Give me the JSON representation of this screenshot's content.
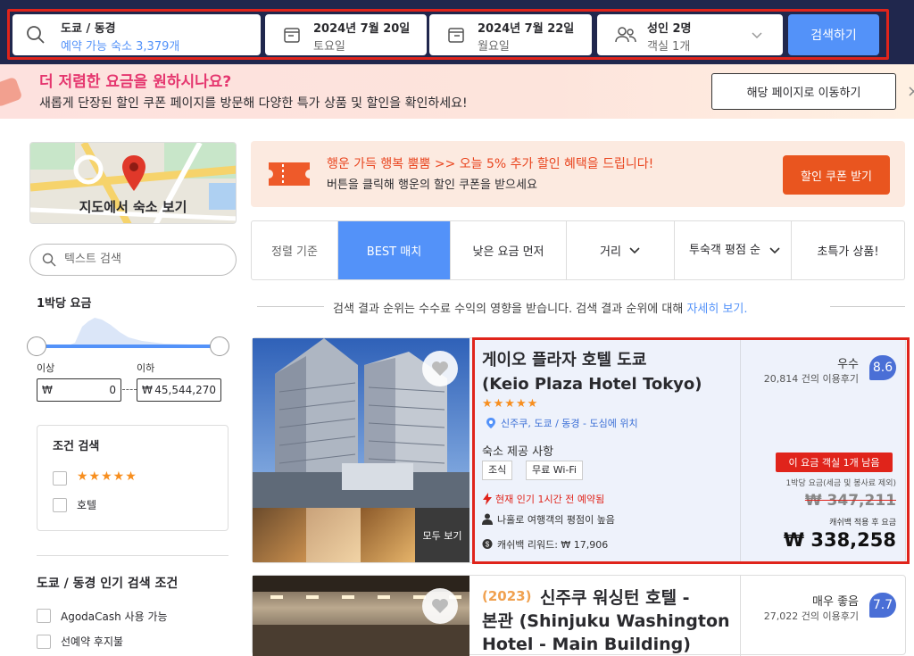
{
  "search": {
    "destination": "도쿄 / 동경",
    "destination_sub": "예약 가능 숙소 3,379개",
    "checkin": "2024년 7월 20일",
    "checkin_day": "토요일",
    "checkout": "2024년 7월 22일",
    "checkout_day": "월요일",
    "guests": "성인 2명",
    "rooms": "객실 1개",
    "search_button": "검색하기"
  },
  "promo": {
    "title": "더 저렴한 요금을 원하시나요?",
    "subtitle": "새롭게 단장된 할인 쿠폰 페이지를 방문해 다양한 특가 상품 및 할인을 확인하세요!",
    "button": "해당 페이지로 이동하기",
    "close": "×"
  },
  "sidebar": {
    "map_label": "지도에서 숙소 보기",
    "text_search_placeholder": "텍스트 검색",
    "price_title": "1박당 요금",
    "min_label": "이상",
    "max_label": "이하",
    "currency": "₩",
    "min_value": "0",
    "max_value": "45,544,270",
    "filter_title": "조건 검색",
    "filters": [
      {
        "label": "★★★★★"
      },
      {
        "label": "호텔"
      }
    ],
    "popular_title": "도쿄 / 동경 인기 검색 조건",
    "popular": [
      {
        "label": "AgodaCash 사용 가능"
      },
      {
        "label": "선예약 후지불"
      }
    ]
  },
  "coupon": {
    "title": "행운 가득 행복 뿜뿜 >> 오늘 5% 추가 할인 혜택을 드립니다!",
    "subtitle": "버튼을 클릭해 행운의 할인 쿠폰을 받으세요",
    "button": "할인 쿠폰 받기"
  },
  "sort": {
    "label": "정렬 기준",
    "options": [
      {
        "label": "BEST 매치"
      },
      {
        "label": "낮은 요금 먼저"
      },
      {
        "label": "거리"
      },
      {
        "label": "투숙객 평점 순"
      },
      {
        "label": "초특가 상품!"
      }
    ]
  },
  "disclaimer": {
    "text": "검색 결과 순위는 수수료 수익의 영향을 받습니다. 검색 결과 순위에 대해",
    "link": "자세히 보기."
  },
  "hotels": [
    {
      "name_ko": "게이오 플라자 호텔 도쿄",
      "name_en": "(Keio Plaza Hotel Tokyo)",
      "stars": "★★★★★",
      "location": "신주쿠, 도쿄 / 동경 - 도심에 위치",
      "amenities_title": "숙소 제공 사항",
      "amenities": [
        "조식",
        "무료 Wi-Fi"
      ],
      "popular": "현재 인기 1시간 전 예약됨",
      "solo": "나홀로 여행객의 평점이 높음",
      "cashback": "캐쉬백 리워드: ₩ 17,906",
      "view_all": "모두 보기",
      "rating_word": "우수",
      "rating_count": "20,814 건의 이용후기",
      "rating_score": "8.6",
      "rooms_left": "이 요금 객실 1개 남음",
      "price_note": "1박당 요금(세금 및 봉사료 제외)",
      "old_price": "₩ 347,211",
      "cashback_note": "캐쉬백 적용 후 요금",
      "price": "₩ 338,258"
    },
    {
      "year": "2023",
      "name_line1": "신주쿠 워싱턴 호텔 -",
      "name_line2": "본관 (Shinjuku Washington",
      "name_line3": "Hotel - Main Building)",
      "rating_word": "매우 좋음",
      "rating_count": "27,022 건의 이용후기",
      "rating_score": "7.7"
    }
  ]
}
